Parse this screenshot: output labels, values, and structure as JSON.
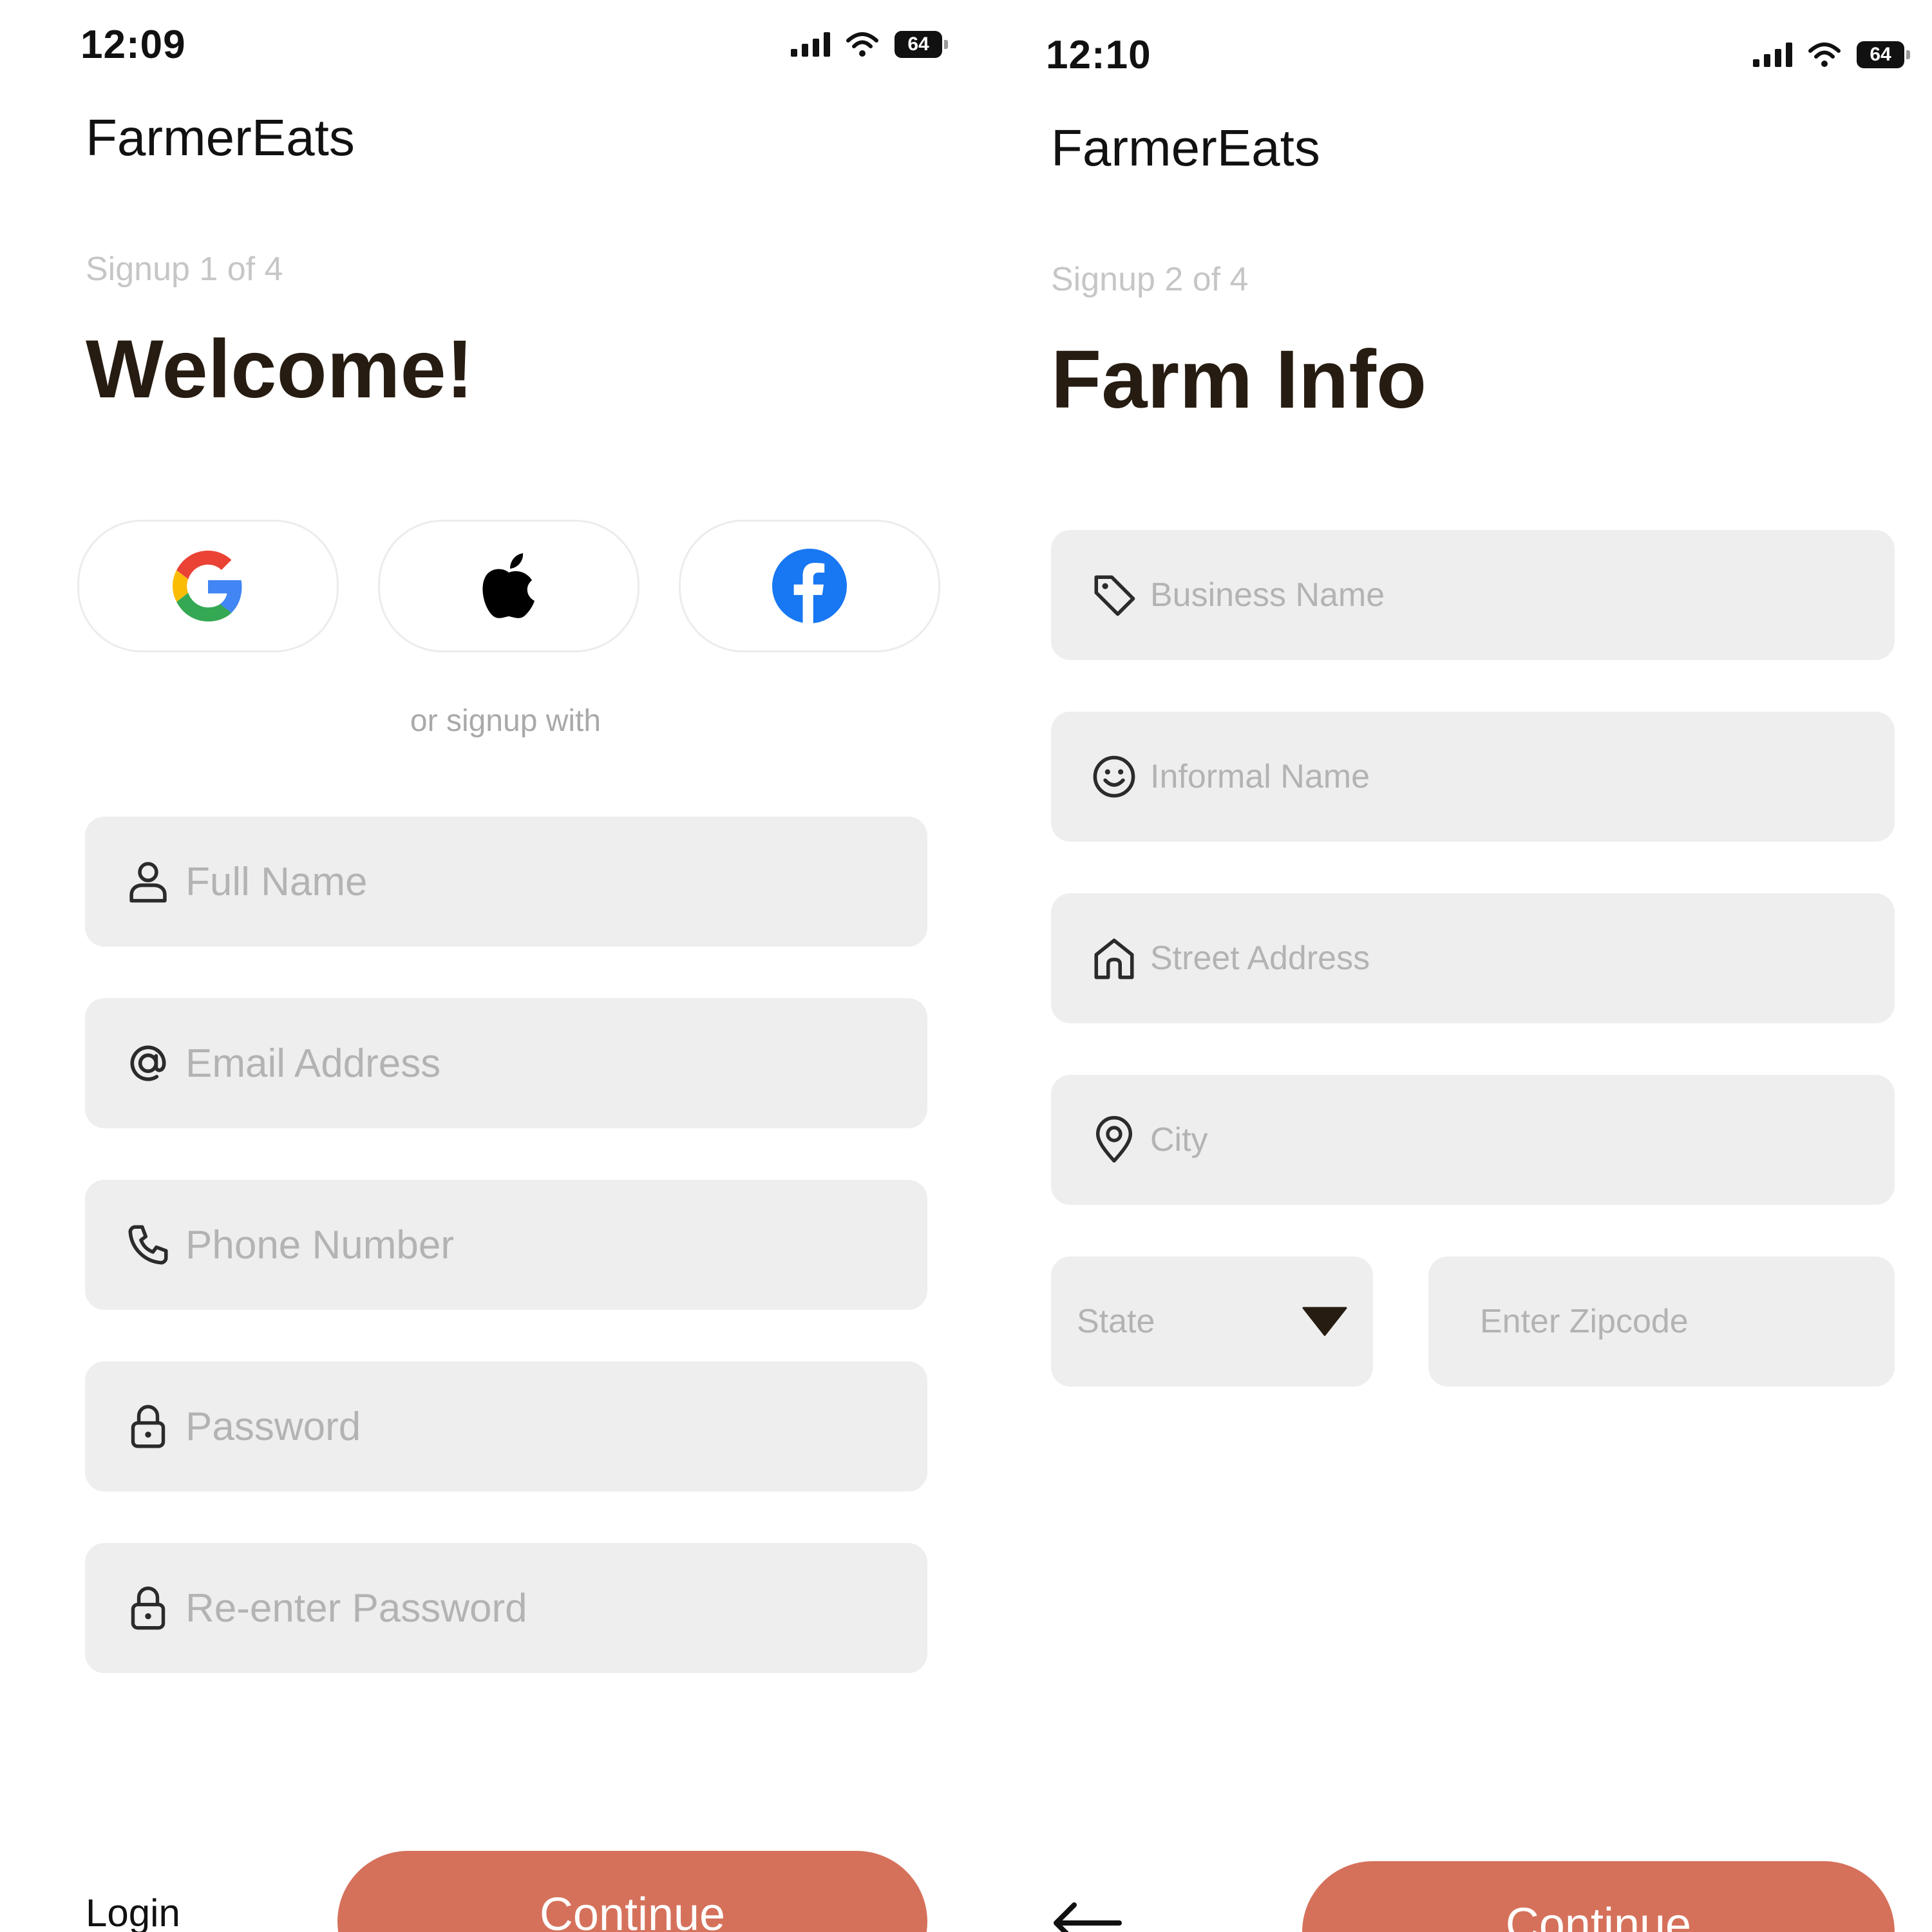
{
  "screens": [
    {
      "status_bar": {
        "time": "12:09",
        "battery": "64"
      },
      "app_title": "FarmerEats",
      "step": "Signup 1 of 4",
      "heading": "Welcome!",
      "social_buttons": [
        "google-icon",
        "apple-icon",
        "facebook-icon"
      ],
      "divider_text": "or signup with",
      "fields": [
        {
          "icon": "user-icon",
          "placeholder": "Full Name"
        },
        {
          "icon": "at-icon",
          "placeholder": "Email Address"
        },
        {
          "icon": "phone-icon",
          "placeholder": "Phone Number"
        },
        {
          "icon": "lock-icon",
          "placeholder": "Password"
        },
        {
          "icon": "lock-icon",
          "placeholder": "Re-enter Password"
        }
      ],
      "footer": {
        "login_label": "Login",
        "continue_label": "Continue"
      }
    },
    {
      "status_bar": {
        "time": "12:10",
        "battery": "64"
      },
      "app_title": "FarmerEats",
      "step": "Signup 2 of 4",
      "heading": "Farm Info",
      "fields": [
        {
          "icon": "tag-icon",
          "placeholder": "Business Name"
        },
        {
          "icon": "smiley-icon",
          "placeholder": "Informal Name"
        },
        {
          "icon": "home-icon",
          "placeholder": "Street Address"
        },
        {
          "icon": "location-pin-icon",
          "placeholder": "City"
        }
      ],
      "state_select": {
        "placeholder": "State",
        "icon": "caret-down-icon"
      },
      "zipcode": {
        "placeholder": "Enter Zipcode"
      },
      "footer": {
        "back_icon": "arrow-left-icon",
        "continue_label": "Continue"
      }
    }
  ],
  "colors": {
    "accent": "#d5715b",
    "heading": "#261c12",
    "field_bg": "#eeeeee",
    "placeholder": "#b3b3b3",
    "muted": "#c6c6c6"
  }
}
